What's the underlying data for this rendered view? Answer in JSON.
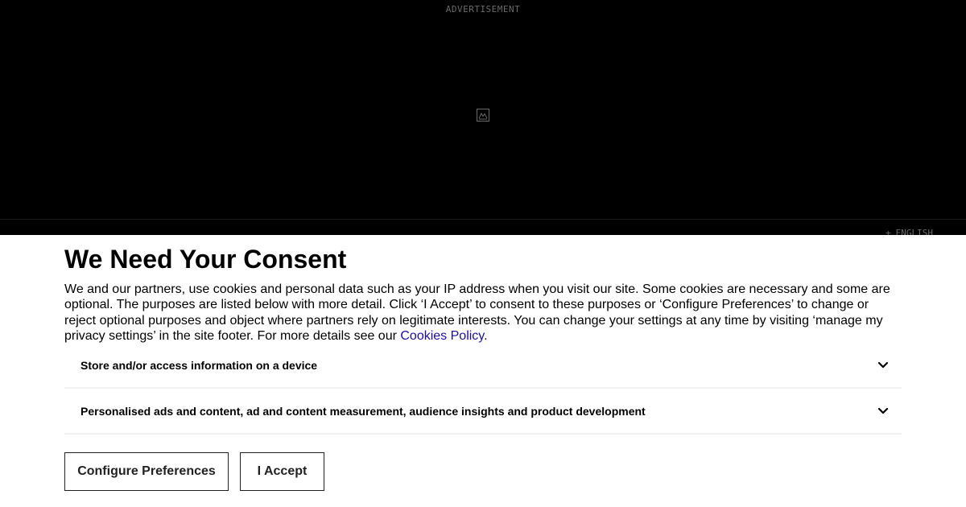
{
  "ad": {
    "label": "ADVERTISEMENT",
    "placeholder_icon": "image-placeholder-icon"
  },
  "language": {
    "icon": "globe-icon",
    "label": "ENGLISH"
  },
  "consent": {
    "title": "We Need Your Consent",
    "body_text": "We and our partners, use cookies and personal data such as your IP address when you visit our site. Some cookies are necessary and some are optional. The purposes are listed below with more detail. Click ‘I Accept’ to consent to these purposes or ‘Configure Preferences’ to change or reject optional purposes and object where partners rely on legitimate interests. You can change your settings at any time by visiting ‘manage my privacy settings’ in the site footer. For more details see our ",
    "policy_link": "Cookies Policy",
    "body_end": ".",
    "purposes": [
      {
        "label": "Store and/or access information on a device",
        "icon": "chevron-down-icon"
      },
      {
        "label": "Personalised ads and content, ad and content measurement, audience insights and product development",
        "icon": "chevron-down-icon"
      }
    ],
    "configure_button": "Configure Preferences",
    "accept_button": "I Accept"
  },
  "colors": {
    "ad_background": "#000000",
    "panel_background": "#ffffff",
    "link": "#1a0dab",
    "muted_text": "#6a6a6a",
    "divider": "#f2f2f2"
  }
}
